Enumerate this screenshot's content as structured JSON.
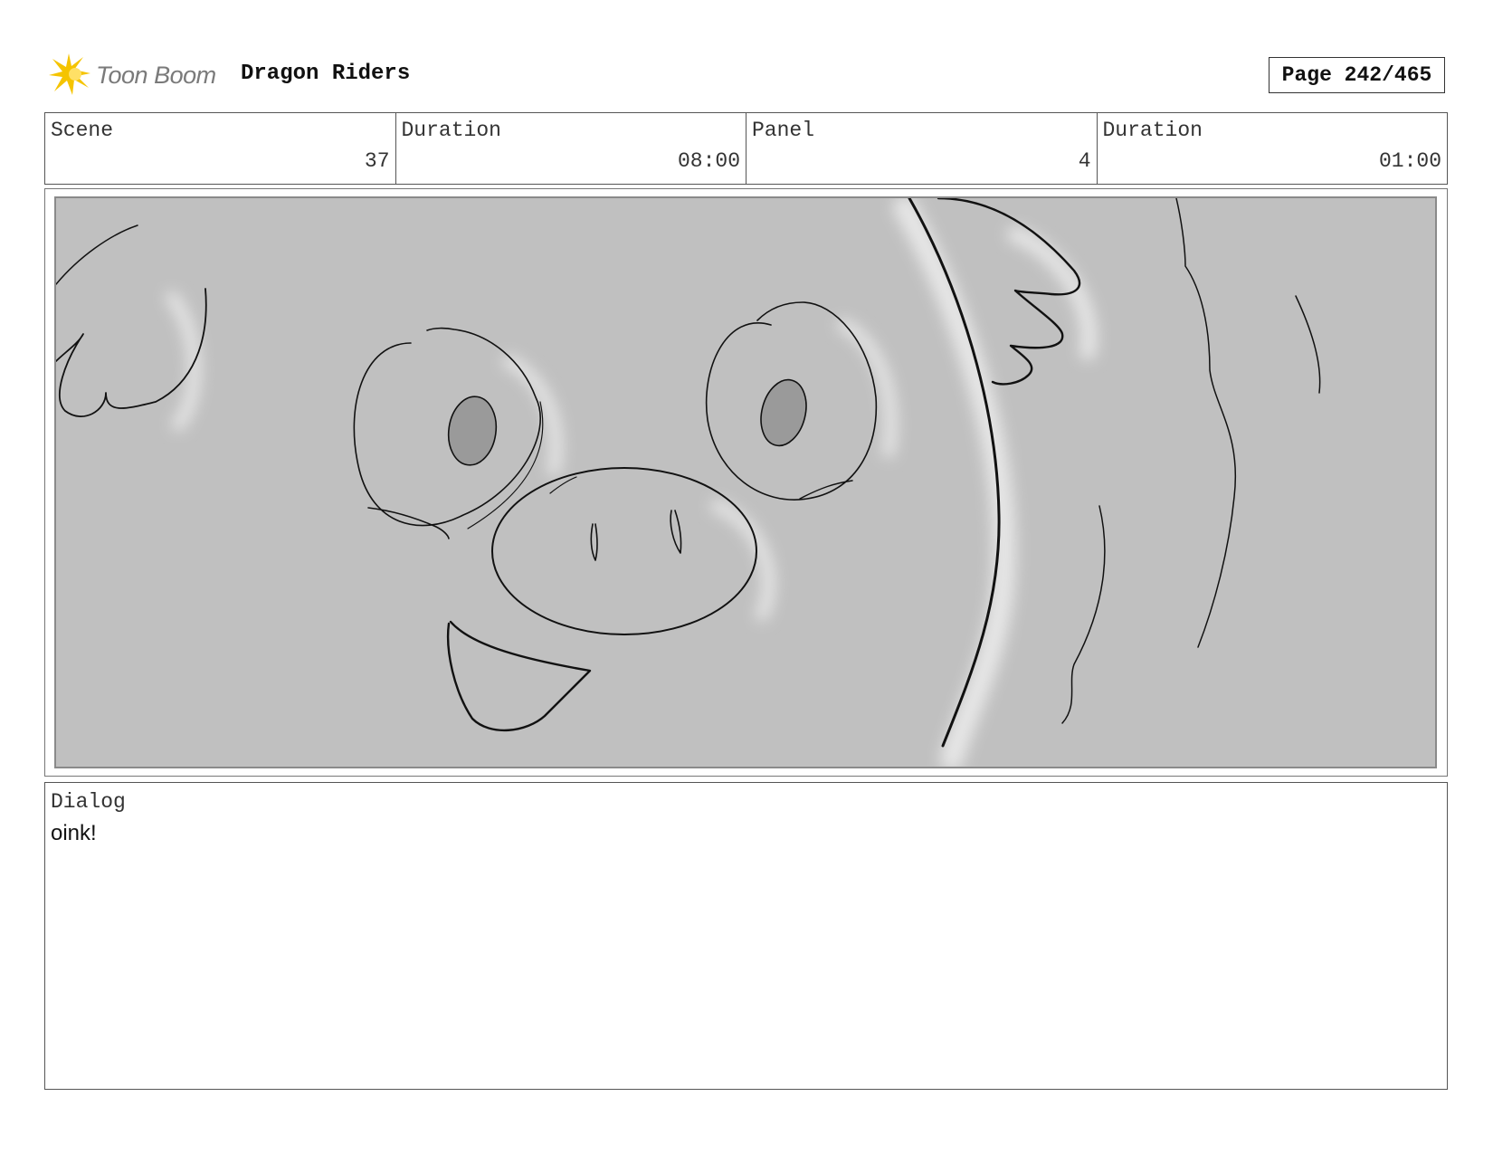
{
  "header": {
    "logo_text": "Toon Boom",
    "project_title": "Dragon Riders",
    "page_indicator": "Page 242/465"
  },
  "info": {
    "scene_label": "Scene",
    "scene_value": "37",
    "scene_duration_label": "Duration",
    "scene_duration_value": "08:00",
    "panel_label": "Panel",
    "panel_value": "4",
    "panel_duration_label": "Duration",
    "panel_duration_value": "01:00"
  },
  "panel": {
    "sketch": "pig-face-sketch",
    "background_color": "#c0c0c0"
  },
  "dialog": {
    "label": "Dialog",
    "text": "oink!"
  },
  "colors": {
    "logo_star": "#f5c400",
    "logo_text": "#7a7a7a"
  }
}
